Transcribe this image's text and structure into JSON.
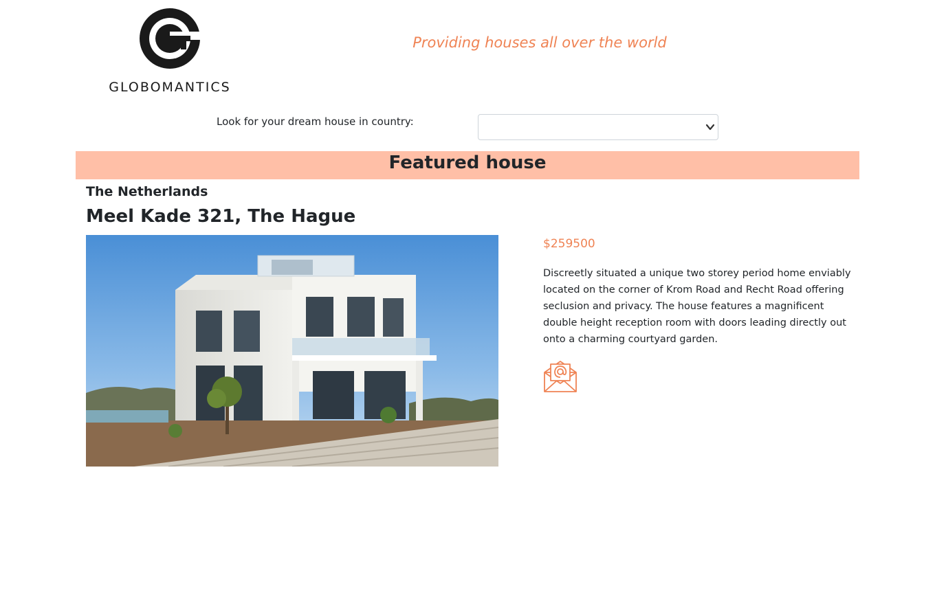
{
  "header": {
    "logo_text": "GLOBOMANTICS",
    "tagline": "Providing houses all over the world"
  },
  "search": {
    "label": "Look for your dream house in country:",
    "selected_value": ""
  },
  "featured": {
    "banner_title": "Featured house",
    "country": "The Netherlands",
    "address": "Meel Kade 321, The Hague",
    "price": "$259500",
    "description": "Discreetly situated a unique two storey period home enviably located on the corner of Krom Road and Recht Road offering seclusion and privacy. The house features a magnificent double height reception room with doors leading directly out onto a charming courtyard garden."
  },
  "colors": {
    "accent": "#ef8354",
    "banner_bg": "#ffbfa7"
  },
  "icons": {
    "email": "envelope-at-icon",
    "select_arrow": "chevron-down-icon"
  }
}
